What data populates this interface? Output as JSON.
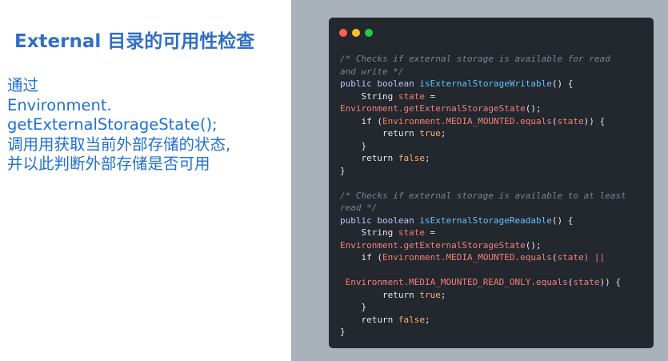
{
  "title": "External 目录的可用性检查",
  "description_lines": [
    "通过",
    "Environment.",
    "getExternalStorageState();",
    "调用用获取当前外部存储的状态,",
    "并以此判断外部存储是否可用"
  ],
  "colors": {
    "title": "#2f6fc4",
    "body_text": "#1f6fd1",
    "code_background": "#23272e",
    "right_panel": "#a9b1ba",
    "comment": "#7b8491",
    "keyword": "#b8c3ff",
    "function": "#5ec4ff",
    "variable": "#f08078",
    "literal": "#f7b36a"
  },
  "code_window": {
    "controls": [
      "close",
      "minimize",
      "maximize"
    ],
    "lines": [
      [
        {
          "t": "/* Checks if external storage is available for read",
          "c": "comment"
        }
      ],
      [
        {
          "t": "and write */",
          "c": "comment"
        }
      ],
      [
        {
          "t": "public boolean ",
          "c": "keyword"
        },
        {
          "t": "isExternalStorageWritable",
          "c": "function"
        },
        {
          "t": "() {",
          "c": "plain"
        }
      ],
      [
        {
          "t": "    String ",
          "c": "plain"
        },
        {
          "t": "state",
          "c": "variable"
        },
        {
          "t": " =",
          "c": "plain"
        }
      ],
      [
        {
          "t": "Environment.getExternalStorageState",
          "c": "variable"
        },
        {
          "t": "();",
          "c": "plain"
        }
      ],
      [
        {
          "t": "    if (",
          "c": "plain"
        },
        {
          "t": "Environment.MEDIA_MOUNTED.equals",
          "c": "variable"
        },
        {
          "t": "(",
          "c": "plain"
        },
        {
          "t": "state",
          "c": "variable"
        },
        {
          "t": ")) {",
          "c": "plain"
        }
      ],
      [
        {
          "t": "        return ",
          "c": "plain"
        },
        {
          "t": "true",
          "c": "literal"
        },
        {
          "t": ";",
          "c": "plain"
        }
      ],
      [
        {
          "t": "    }",
          "c": "plain"
        }
      ],
      [
        {
          "t": "    return ",
          "c": "plain"
        },
        {
          "t": "false",
          "c": "literal"
        },
        {
          "t": ";",
          "c": "plain"
        }
      ],
      [
        {
          "t": "}",
          "c": "plain"
        }
      ],
      [
        {
          "t": "",
          "c": "plain"
        }
      ],
      [
        {
          "t": "/* Checks if external storage is available to at least",
          "c": "comment"
        }
      ],
      [
        {
          "t": "read */",
          "c": "comment"
        }
      ],
      [
        {
          "t": "public boolean ",
          "c": "keyword"
        },
        {
          "t": "isExternalStorageReadable",
          "c": "function"
        },
        {
          "t": "() {",
          "c": "plain"
        }
      ],
      [
        {
          "t": "    String ",
          "c": "plain"
        },
        {
          "t": "state",
          "c": "variable"
        },
        {
          "t": " =",
          "c": "plain"
        }
      ],
      [
        {
          "t": "Environment.getExternalStorageState",
          "c": "variable"
        },
        {
          "t": "();",
          "c": "plain"
        }
      ],
      [
        {
          "t": "    if (",
          "c": "plain"
        },
        {
          "t": "Environment.MEDIA_MOUNTED.equals",
          "c": "variable"
        },
        {
          "t": "(",
          "c": "plain"
        },
        {
          "t": "state",
          "c": "variable"
        },
        {
          "t": ") ||",
          "c": "variable"
        }
      ],
      [
        {
          "t": "",
          "c": "plain"
        }
      ],
      [
        {
          "t": " Environment.MEDIA_MOUNTED_READ_ONLY.equals",
          "c": "variable"
        },
        {
          "t": "(",
          "c": "plain"
        },
        {
          "t": "state",
          "c": "variable"
        },
        {
          "t": ")) {",
          "c": "plain"
        }
      ],
      [
        {
          "t": "        return ",
          "c": "plain"
        },
        {
          "t": "true",
          "c": "literal"
        },
        {
          "t": ";",
          "c": "plain"
        }
      ],
      [
        {
          "t": "    }",
          "c": "plain"
        }
      ],
      [
        {
          "t": "    return ",
          "c": "plain"
        },
        {
          "t": "false",
          "c": "literal"
        },
        {
          "t": ";",
          "c": "plain"
        }
      ],
      [
        {
          "t": "}",
          "c": "plain"
        }
      ]
    ]
  }
}
